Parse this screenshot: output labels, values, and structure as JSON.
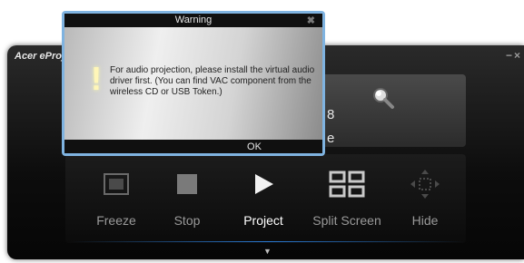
{
  "app": {
    "title": "Acer eProjection",
    "minimize": "−",
    "close": "×",
    "info_line1": "8",
    "info_line2": "e"
  },
  "toolbar": {
    "items": [
      {
        "label": "Freeze",
        "icon": "freeze-icon",
        "active": false
      },
      {
        "label": "Stop",
        "icon": "stop-icon",
        "active": false
      },
      {
        "label": "Project",
        "icon": "play-icon",
        "active": true
      },
      {
        "label": "Split Screen",
        "icon": "split-screen-icon",
        "active": false
      },
      {
        "label": "Hide",
        "icon": "hide-icon",
        "active": false
      }
    ],
    "expand": "▼"
  },
  "dialog": {
    "title": "Warning",
    "close": "✖",
    "icon": "!",
    "message": "For audio projection, please install the virtual audio driver first. (You can find VAC component from the wireless CD or USB Token.)",
    "ok": "OK"
  },
  "colors": {
    "dialog_border": "#7fb3e0",
    "app_bg": "#0d0d0d",
    "accent_line": "#2a7bd6"
  }
}
